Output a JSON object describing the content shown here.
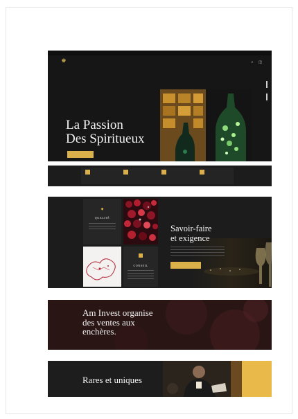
{
  "hero": {
    "topbar_left": "",
    "topbar_right": "",
    "logo_text": "",
    "menu": [
      "",
      "",
      "",
      "",
      "",
      ""
    ],
    "kicker": "",
    "title_line1": "La Passion",
    "title_line2": "Des Spiritueux",
    "cta_label": "",
    "secondary_link": ""
  },
  "features": [
    {
      "label": "",
      "sub": ""
    },
    {
      "label": "",
      "sub": ""
    },
    {
      "label": "",
      "sub": ""
    },
    {
      "label": "",
      "sub": ""
    }
  ],
  "savoir": {
    "tile_qualite_title": "QUALITÉ",
    "tile_conseil_title": "CONSEIL",
    "kicker": "",
    "title_line1": "Savoir-faire",
    "title_line2": "et exigence",
    "cta_label": ""
  },
  "encheres": {
    "kicker": "",
    "title_line1": "Am Invest organise",
    "title_line2": "des ventes aux",
    "title_line3": "enchères.",
    "link": ""
  },
  "rares": {
    "kicker": "",
    "title": "Rares et uniques",
    "sub": ""
  },
  "colors": {
    "accent_gold": "#d9b04a",
    "dark_bg": "#1a1a1a",
    "auction_bg": "#2a1616",
    "text_light": "#f2f2f2"
  },
  "icons": {
    "search": "search-icon",
    "cart": "cart-icon",
    "quality": "diamond-icon",
    "advice": "square-icon"
  }
}
